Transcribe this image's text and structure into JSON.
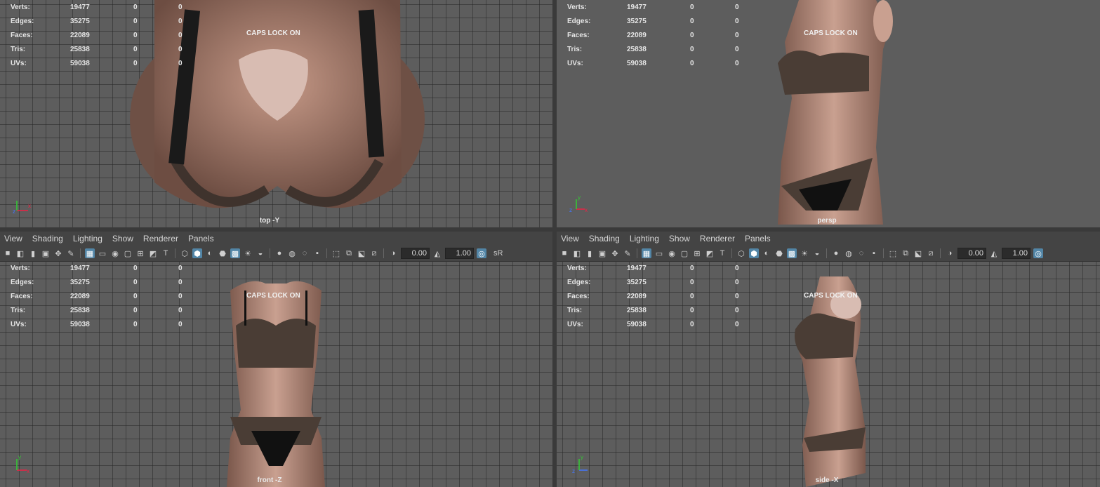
{
  "menu": [
    "View",
    "Shading",
    "Lighting",
    "Show",
    "Renderer",
    "Panels"
  ],
  "stats": [
    {
      "label": "Verts:",
      "value": "19477",
      "a": "0",
      "b": "0"
    },
    {
      "label": "Edges:",
      "value": "35275",
      "a": "0",
      "b": "0"
    },
    {
      "label": "Faces:",
      "value": "22089",
      "a": "0",
      "b": "0"
    },
    {
      "label": "Tris:",
      "value": "25838",
      "a": "0",
      "b": "0"
    },
    {
      "label": "UVs:",
      "value": "59038",
      "a": "0",
      "b": "0"
    }
  ],
  "caps": "CAPS LOCK ON",
  "toolbar": {
    "exposure": "0.00",
    "gamma": "1.00",
    "srgb": "sR"
  },
  "cameras": {
    "top": "top -Y",
    "persp": "persp",
    "front": "front -Z",
    "side": "side -X"
  },
  "axes": {
    "x": "x",
    "y": "y",
    "z": "z"
  },
  "colors": {
    "viewport": "#5d5d5d",
    "skin": "#a67f70",
    "lace": "#4a3d35",
    "active": "#5285a6"
  }
}
